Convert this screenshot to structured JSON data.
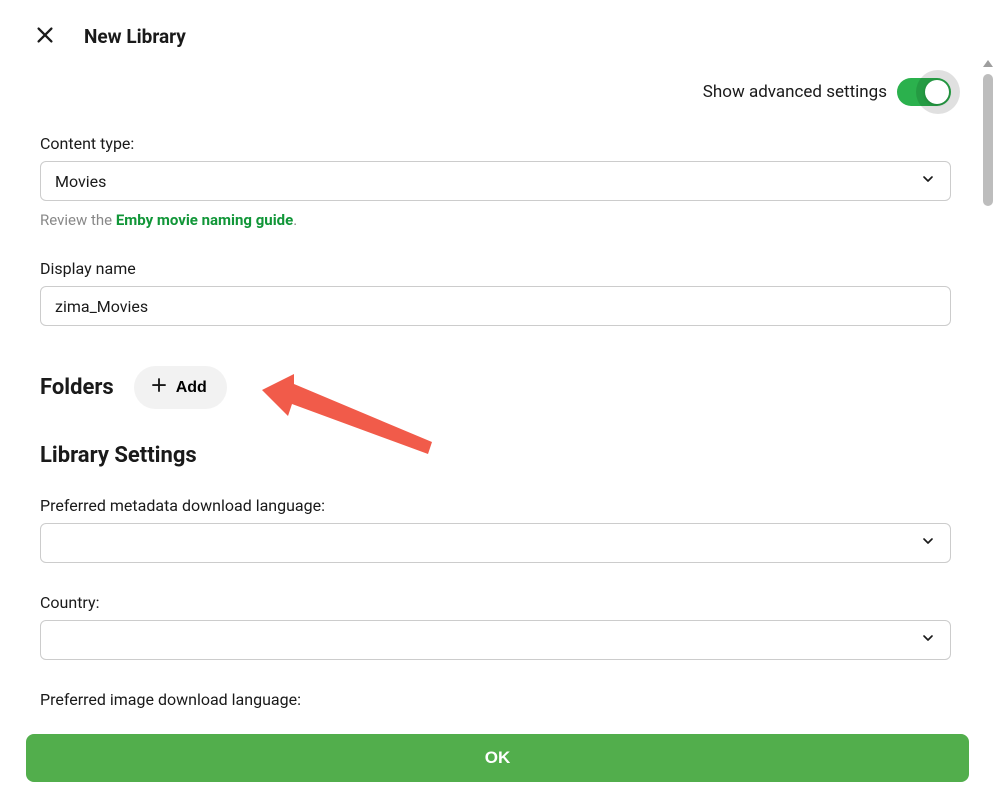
{
  "header": {
    "title": "New Library"
  },
  "advanced": {
    "label": "Show advanced settings",
    "on": true
  },
  "content_type": {
    "label": "Content type:",
    "value": "Movies",
    "helper_prefix": "Review the ",
    "helper_link": "Emby movie naming guide",
    "helper_suffix": "."
  },
  "display_name": {
    "label": "Display name",
    "value": "zima_Movies"
  },
  "folders": {
    "title": "Folders",
    "add_label": "Add"
  },
  "library_settings": {
    "title": "Library Settings",
    "pref_metadata_lang": {
      "label": "Preferred metadata download language:",
      "value": ""
    },
    "country": {
      "label": "Country:",
      "value": ""
    },
    "pref_image_lang": {
      "label": "Preferred image download language:",
      "value": ""
    }
  },
  "footer": {
    "ok": "OK"
  }
}
